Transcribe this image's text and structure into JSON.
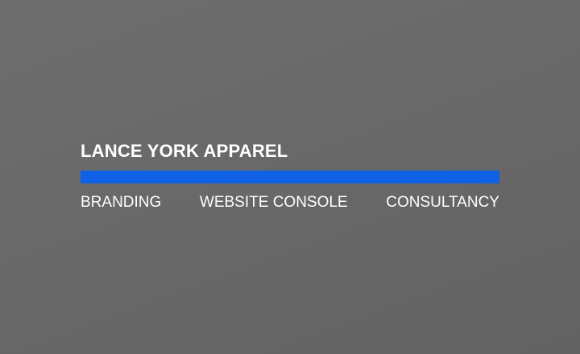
{
  "brand": {
    "name": "LANCE YORK APPAREL",
    "accent_color": "#0f62e6",
    "background_color": "#686767"
  },
  "services": [
    {
      "label": "BRANDING"
    },
    {
      "label": "WEBSITE CONSOLE"
    },
    {
      "label": "CONSULTANCY"
    }
  ]
}
